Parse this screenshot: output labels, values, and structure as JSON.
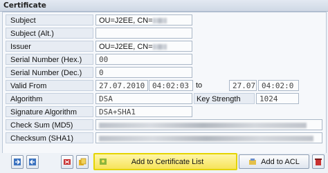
{
  "title": "Certificate",
  "rows": {
    "subject": {
      "label": "Subject",
      "value": "OU=J2EE, CN="
    },
    "subject_alt": {
      "label": "Subject (Alt.)",
      "value": ""
    },
    "issuer": {
      "label": "Issuer",
      "value": "OU=J2EE, CN="
    },
    "serial_hex": {
      "label": "Serial Number (Hex.)",
      "value": "00"
    },
    "serial_dec": {
      "label": "Serial Number (Dec.)",
      "value": "0"
    },
    "valid_from": {
      "label": "Valid From",
      "date_from": "27.07.2010",
      "time_from": "04:02:03",
      "to_label": "to",
      "date_to": "27.07",
      "time_to": "04:02:0"
    },
    "algorithm": {
      "label": "Algorithm",
      "value": "DSA",
      "key_strength_label": "Key Strength",
      "key_strength": "1024"
    },
    "signature_algorithm": {
      "label": "Signature Algorithm",
      "value": "DSA+SHA1"
    },
    "check_sum": {
      "label": "Check Sum (MD5)",
      "value": ""
    },
    "checksum_sha1": {
      "label": "Checksum (SHA1)",
      "value": ""
    }
  },
  "buttons": {
    "add_to_certificate_list": "Add to Certificate List",
    "add_to_acl": "Add to ACL"
  }
}
